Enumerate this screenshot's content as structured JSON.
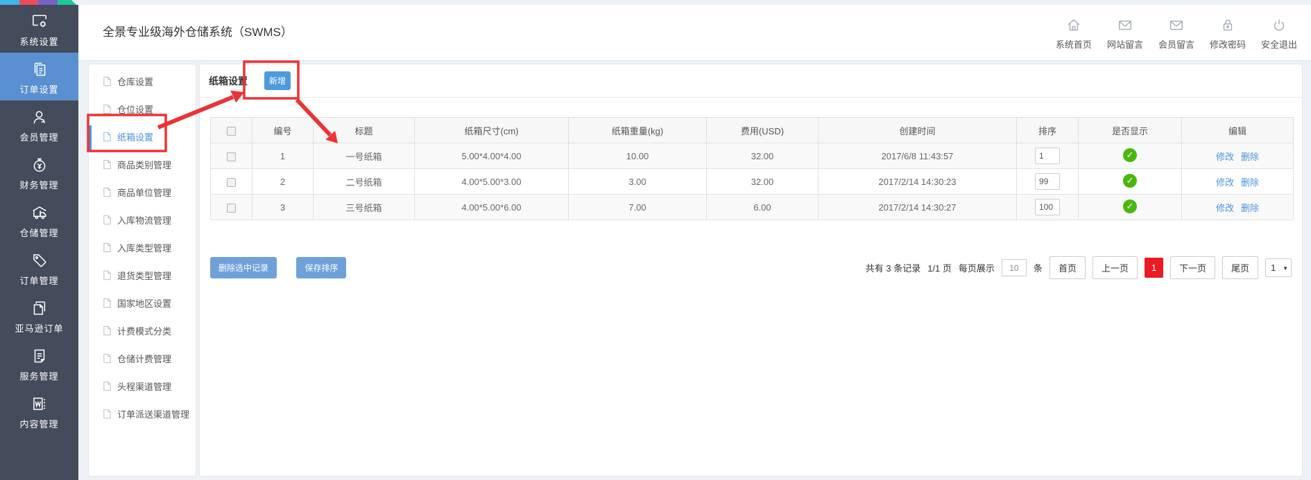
{
  "app_title": "全景专业级海外仓储系统（SWMS）",
  "topnav": [
    {
      "label": "系统首页",
      "icon": "home-icon"
    },
    {
      "label": "网站留言",
      "icon": "mail-icon"
    },
    {
      "label": "会员留言",
      "icon": "mail-icon"
    },
    {
      "label": "修改密码",
      "icon": "lock-icon"
    },
    {
      "label": "安全退出",
      "icon": "power-icon"
    }
  ],
  "sidebar": [
    {
      "label": "系统设置",
      "icon": "monitor-gear-icon",
      "active": false
    },
    {
      "label": "订单设置",
      "icon": "copy-docs-icon",
      "active": true
    },
    {
      "label": "会员管理",
      "icon": "user-icon",
      "active": false
    },
    {
      "label": "财务管理",
      "icon": "money-bag-icon",
      "active": false
    },
    {
      "label": "仓储管理",
      "icon": "warehouse-truck-icon",
      "active": false
    },
    {
      "label": "订单管理",
      "icon": "tag-icon",
      "active": false
    },
    {
      "label": "亚马逊订单",
      "icon": "pages-icon",
      "active": false
    },
    {
      "label": "服务管理",
      "icon": "document-lines-icon",
      "active": false
    },
    {
      "label": "内容管理",
      "icon": "word-doc-icon",
      "active": false
    }
  ],
  "submenu": {
    "items": [
      "仓库设置",
      "仓位设置",
      "纸箱设置",
      "商品类别管理",
      "商品单位管理",
      "入库物流管理",
      "入库类型管理",
      "退货类型管理",
      "国家地区设置",
      "计费模式分类",
      "仓储计费管理",
      "头程渠道管理",
      "订单派送渠道管理"
    ],
    "active": "纸箱设置"
  },
  "main": {
    "title": "纸箱设置",
    "add_button": "新增",
    "table": {
      "headers": [
        "编号",
        "标题",
        "纸箱尺寸(cm)",
        "纸箱重量(kg)",
        "费用(USD)",
        "创建时间",
        "排序",
        "是否显示",
        "编辑"
      ],
      "edit_label": "修改",
      "delete_label": "删除",
      "rows": [
        {
          "no": "1",
          "title": "一号纸箱",
          "size": "5.00*4.00*4.00",
          "weight": "10.00",
          "fee": "32.00",
          "created": "2017/6/8 11:43:57",
          "sort": "1",
          "visible": true
        },
        {
          "no": "2",
          "title": "二号纸箱",
          "size": "4.00*5.00*3.00",
          "weight": "3.00",
          "fee": "32.00",
          "created": "2017/2/14 14:30:23",
          "sort": "99",
          "visible": true
        },
        {
          "no": "3",
          "title": "三号纸箱",
          "size": "4.00*5.00*6.00",
          "weight": "7.00",
          "fee": "6.00",
          "created": "2017/2/14 14:30:27",
          "sort": "100",
          "visible": true
        }
      ]
    },
    "actions": {
      "delete_selected": "删除选中记录",
      "save_sort": "保存排序"
    },
    "pagination": {
      "summary_total": "共有 3 条记录",
      "page_info": "1/1 页",
      "per_page_prefix": "每页展示",
      "per_page_value": "10",
      "per_page_suffix": "条",
      "first": "首页",
      "prev": "上一页",
      "current": "1",
      "next": "下一页",
      "last": "尾页",
      "jump_value": "1"
    }
  },
  "colors": {
    "sidebar_bg": "#444b5a",
    "sidebar_active": "#5990d2",
    "accent_blue": "#4e9add",
    "link_blue": "#4b94db",
    "annotation_red": "#ec3235",
    "pagination_current_red": "#ea1b22",
    "visible_green": "#4ab711",
    "strip_colors": [
      "#41b5e9",
      "#ed4a5b",
      "#7464c8",
      "#1dc796"
    ]
  }
}
